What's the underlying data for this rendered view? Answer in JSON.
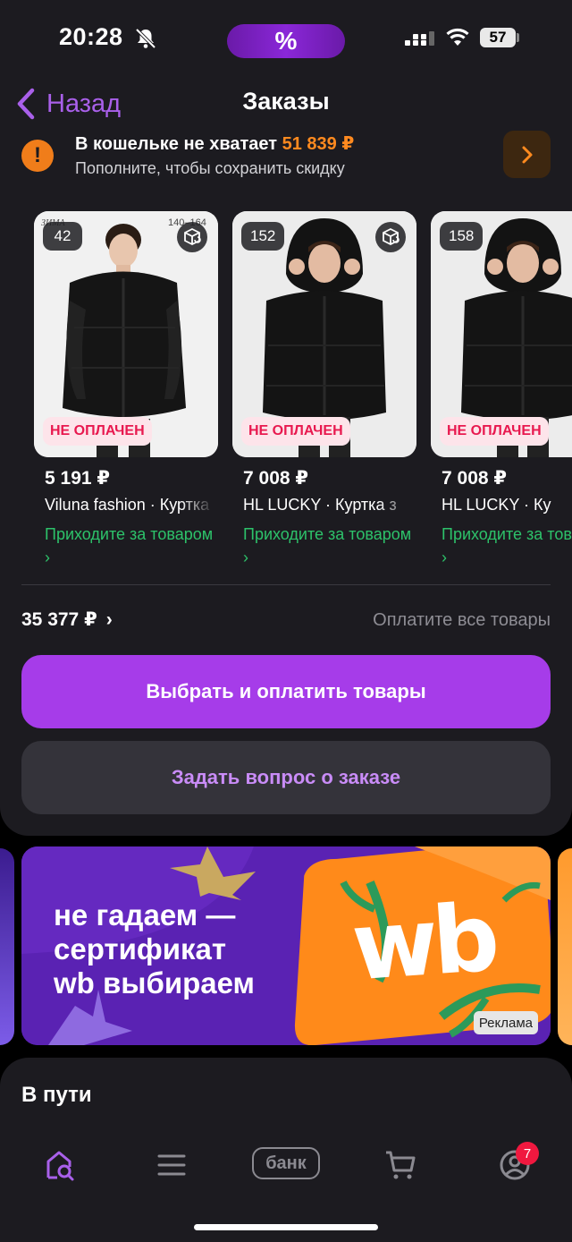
{
  "status_bar": {
    "time": "20:28",
    "promo_symbol": "%",
    "battery": "57"
  },
  "header": {
    "back_label": "Назад",
    "title": "Заказы"
  },
  "wallet": {
    "title_prefix": "В кошельке не хватает ",
    "amount": "51 839 ₽",
    "subtitle": "Пополните, чтобы сохранить скидку"
  },
  "products": [
    {
      "quantity": "42",
      "status": "НЕ ОПЛАЧЕН",
      "price": "5 191 ₽",
      "brand": "Viluna fashion · Куртка",
      "pickup": "Приходите за товаром ›"
    },
    {
      "quantity": "152",
      "status": "НЕ ОПЛАЧЕН",
      "price": "7 008 ₽",
      "brand": "HL LUCKY · Куртка з",
      "pickup": "Приходите за товаром ›"
    },
    {
      "quantity": "158",
      "status": "НЕ ОПЛАЧЕН",
      "price": "7 008 ₽",
      "brand": "HL LUCKY · Ку",
      "pickup": "Приходите за товаром ›"
    }
  ],
  "summary": {
    "total": "35 377 ₽",
    "total_arrow": "›",
    "hint": "Оплатите все товары"
  },
  "actions": {
    "primary": "Выбрать и оплатить товары",
    "secondary": "Задать вопрос о заказе"
  },
  "banner": {
    "text": "не гадаем —\nсертификат\nwb выбираем",
    "logo": "wb",
    "ad_label": "Реклама"
  },
  "transit": {
    "title": "В пути"
  },
  "tabbar": {
    "bank_label": "банк",
    "profile_badge": "7"
  },
  "colors": {
    "accent": "#a63ce9",
    "warning": "#f07d1a",
    "success": "#2dc26a",
    "unpaid": "#e8194f",
    "background": "#1c1b20"
  }
}
